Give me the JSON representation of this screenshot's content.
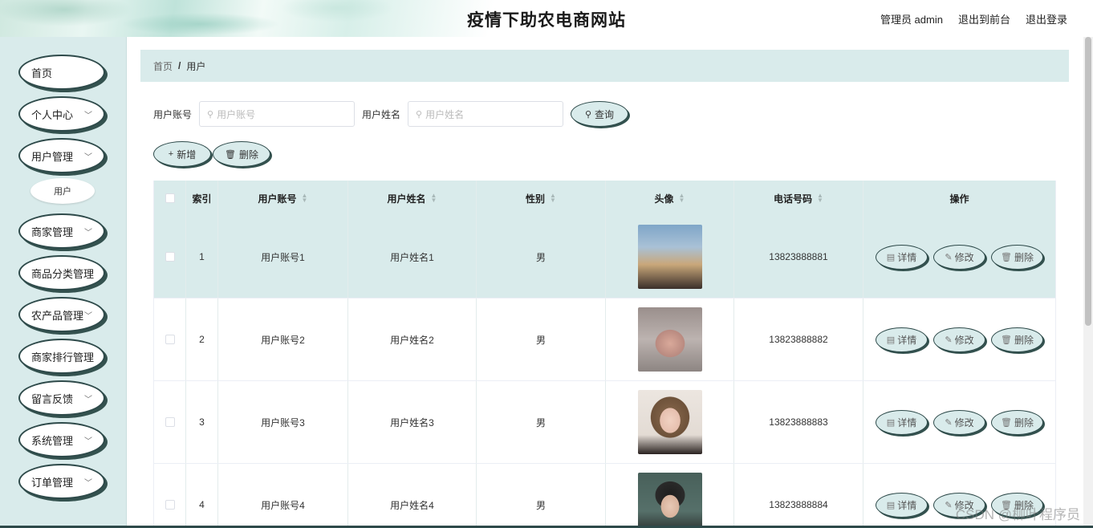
{
  "header": {
    "title": "疫情下助农电商网站",
    "admin_label": "管理员 admin",
    "back_front": "退出到前台",
    "logout": "退出登录"
  },
  "sidebar": {
    "items": [
      {
        "label": "首页",
        "has_chevron": false
      },
      {
        "label": "个人中心",
        "has_chevron": true
      },
      {
        "label": "用户管理",
        "has_chevron": true
      },
      {
        "label": "商家管理",
        "has_chevron": true
      },
      {
        "label": "商品分类管理",
        "has_chevron": false
      },
      {
        "label": "农产品管理",
        "has_chevron": true
      },
      {
        "label": "商家排行管理",
        "has_chevron": false
      },
      {
        "label": "留言反馈",
        "has_chevron": true
      },
      {
        "label": "系统管理",
        "has_chevron": true
      },
      {
        "label": "订单管理",
        "has_chevron": true
      }
    ],
    "sub_item": "用户"
  },
  "breadcrumb": {
    "home": "首页",
    "sep": "/",
    "current": "用户"
  },
  "search": {
    "account_label": "用户账号",
    "account_placeholder": "用户账号",
    "name_label": "用户姓名",
    "name_placeholder": "用户姓名",
    "query_button": "查询"
  },
  "actions": {
    "add": "新增",
    "delete": "删除"
  },
  "table": {
    "headers": {
      "index": "索引",
      "account": "用户账号",
      "name": "用户姓名",
      "gender": "性别",
      "avatar": "头像",
      "phone": "电话号码",
      "ops": "操作"
    },
    "rows": [
      {
        "index": "1",
        "account": "用户账号1",
        "name": "用户姓名1",
        "gender": "男",
        "phone": "13823888881"
      },
      {
        "index": "2",
        "account": "用户账号2",
        "name": "用户姓名2",
        "gender": "男",
        "phone": "13823888882"
      },
      {
        "index": "3",
        "account": "用户账号3",
        "name": "用户姓名3",
        "gender": "男",
        "phone": "13823888883"
      },
      {
        "index": "4",
        "account": "用户账号4",
        "name": "用户姓名4",
        "gender": "男",
        "phone": "13823888884"
      }
    ],
    "op_labels": {
      "detail": "详情",
      "edit": "修改",
      "delete": "删除"
    }
  },
  "watermark": "CSDN @柳叶程序员",
  "colors": {
    "accent": "#d9ebeb",
    "border_dark": "#2e4a4a"
  }
}
